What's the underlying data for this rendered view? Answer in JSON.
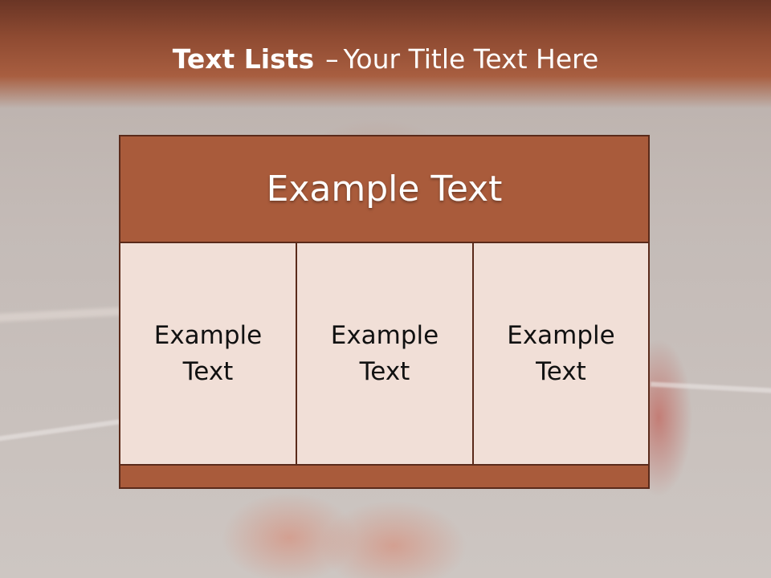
{
  "title": {
    "bold": "Text Lists",
    "separator": "–",
    "rest": "Your Title Text Here"
  },
  "table": {
    "header": "Example Text",
    "columns": [
      {
        "text": "Example Text"
      },
      {
        "text": "Example Text"
      },
      {
        "text": "Example Text"
      }
    ]
  },
  "colors": {
    "title_band": "#8f4b32",
    "table_fill": "#a95b3b",
    "cell_fill": "#f1dfd7",
    "border": "#5a2a1a"
  }
}
